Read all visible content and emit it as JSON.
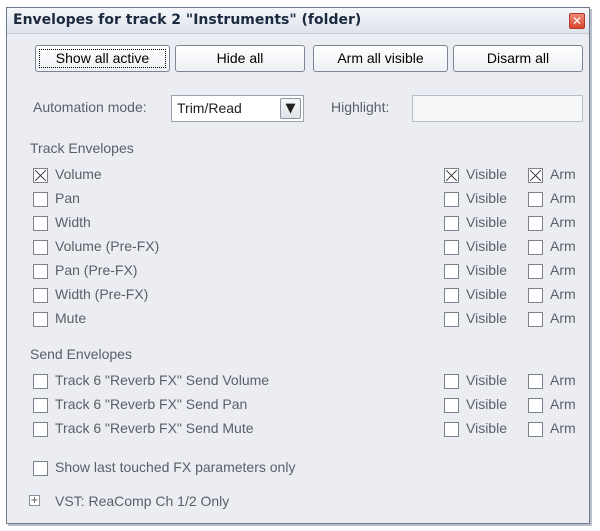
{
  "window": {
    "title": "Envelopes for track 2 \"Instruments\" (folder)",
    "close_glyph": "✕"
  },
  "buttons": {
    "show_all_active": "Show all active",
    "hide_all": "Hide all",
    "arm_all_visible": "Arm all visible",
    "disarm_all": "Disarm all"
  },
  "automation": {
    "label": "Automation mode:",
    "mode_value": "Trim/Read",
    "arrow_glyph": "▼",
    "highlight_label": "Highlight:",
    "highlight_value": ""
  },
  "track_envelopes": {
    "heading": "Track Envelopes",
    "items": [
      {
        "label": "Volume",
        "enabled": true,
        "visible_label": "Visible",
        "visible": true,
        "arm_label": "Arm",
        "arm": true
      },
      {
        "label": "Pan",
        "enabled": false,
        "visible_label": "Visible",
        "visible": false,
        "arm_label": "Arm",
        "arm": false
      },
      {
        "label": "Width",
        "enabled": false,
        "visible_label": "Visible",
        "visible": false,
        "arm_label": "Arm",
        "arm": false
      },
      {
        "label": "Volume (Pre-FX)",
        "enabled": false,
        "visible_label": "Visible",
        "visible": false,
        "arm_label": "Arm",
        "arm": false
      },
      {
        "label": "Pan (Pre-FX)",
        "enabled": false,
        "visible_label": "Visible",
        "visible": false,
        "arm_label": "Arm",
        "arm": false
      },
      {
        "label": "Width (Pre-FX)",
        "enabled": false,
        "visible_label": "Visible",
        "visible": false,
        "arm_label": "Arm",
        "arm": false
      },
      {
        "label": "Mute",
        "enabled": false,
        "visible_label": "Visible",
        "visible": false,
        "arm_label": "Arm",
        "arm": false
      }
    ]
  },
  "send_envelopes": {
    "heading": "Send Envelopes",
    "items": [
      {
        "label": "Track 6 \"Reverb FX\" Send Volume",
        "enabled": false,
        "visible_label": "Visible",
        "visible": false,
        "arm_label": "Arm",
        "arm": false
      },
      {
        "label": "Track 6 \"Reverb FX\" Send Pan",
        "enabled": false,
        "visible_label": "Visible",
        "visible": false,
        "arm_label": "Arm",
        "arm": false
      },
      {
        "label": "Track 6 \"Reverb FX\" Send Mute",
        "enabled": false,
        "visible_label": "Visible",
        "visible": false,
        "arm_label": "Arm",
        "arm": false
      }
    ]
  },
  "show_last_touched": {
    "label": "Show last touched FX parameters only",
    "checked": false
  },
  "fx_tree": {
    "expand_glyph": "+",
    "label": "VST: ReaComp Ch 1/2 Only"
  },
  "colors": {
    "window_bg": "#ebedf3",
    "title_text": "#1c2a40",
    "close_bg": "#d9452e",
    "label_text": "#5a5f66"
  }
}
